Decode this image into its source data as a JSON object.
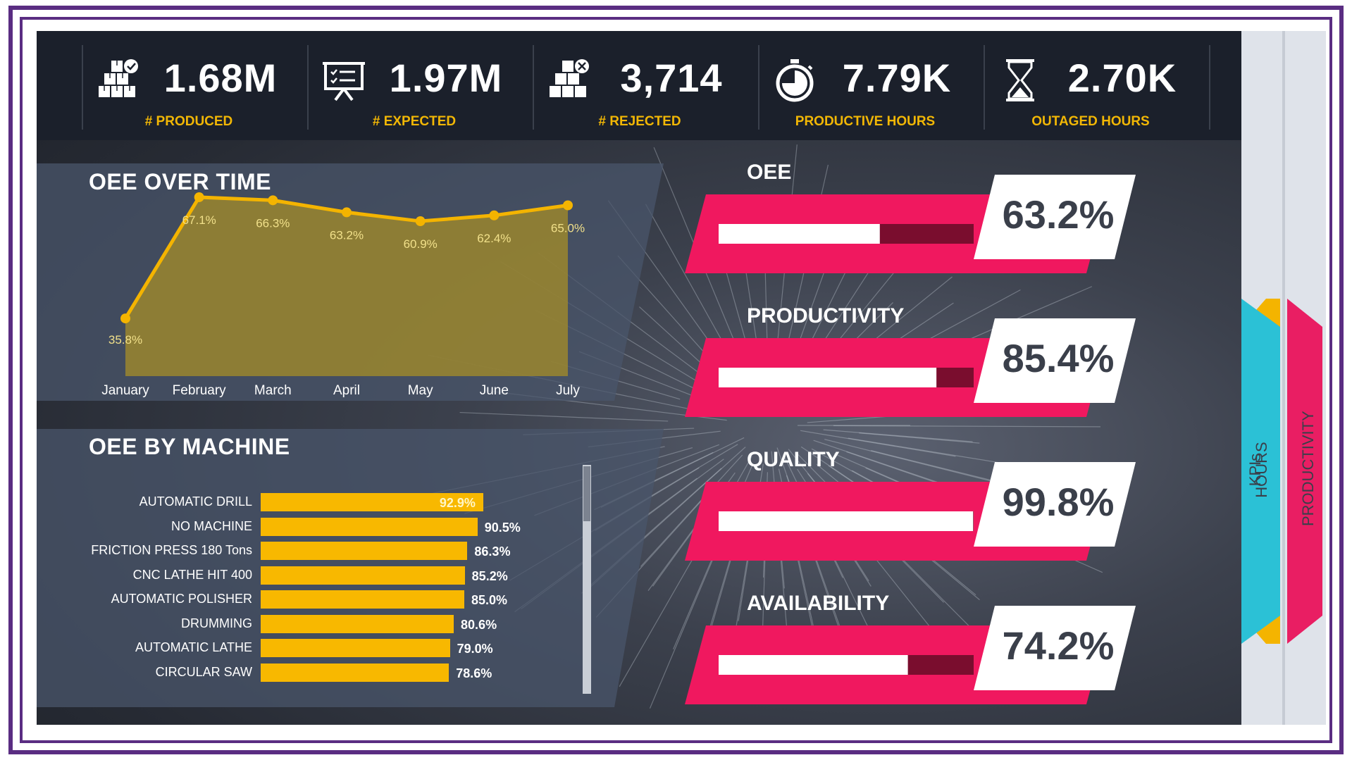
{
  "kpis": [
    {
      "value": "1.68M",
      "label": "# PRODUCED",
      "icon": "boxes-check-icon"
    },
    {
      "value": "1.97M",
      "label": "# EXPECTED",
      "icon": "presentation-board-icon"
    },
    {
      "value": "3,714",
      "label": "# REJECTED",
      "icon": "boxes-x-icon"
    },
    {
      "value": "7.79K",
      "label": "PRODUCTIVE HOURS",
      "icon": "stopwatch-icon"
    },
    {
      "value": "2.70K",
      "label": "OUTAGED HOURS",
      "icon": "hourglass-icon"
    }
  ],
  "oee_over_time": {
    "title": "OEE OVER TIME"
  },
  "oee_by_machine": {
    "title": "OEE BY MACHINE"
  },
  "gauges": [
    {
      "title": "OEE",
      "value": "63.2%",
      "fraction": 0.632
    },
    {
      "title": "PRODUCTIVITY",
      "value": "85.4%",
      "fraction": 0.854
    },
    {
      "title": "QUALITY",
      "value": "99.8%",
      "fraction": 0.998
    },
    {
      "title": "AVAILABILITY",
      "value": "74.2%",
      "fraction": 0.742
    }
  ],
  "tabs": [
    {
      "label": "KPIs",
      "color": "#f4b400"
    },
    {
      "label": "HOURS",
      "color": "#2bc1d6"
    },
    {
      "label": "PRODUCTIVITY",
      "color": "#e91e63"
    }
  ],
  "colors": {
    "accent_yellow": "#f4b400",
    "gauge_pink": "#f0185f",
    "gauge_dark": "#7a0d2e",
    "bar_yellow": "#f8b800"
  },
  "chart_data": [
    {
      "type": "area",
      "title": "OEE OVER TIME",
      "categories": [
        "January",
        "February",
        "March",
        "April",
        "May",
        "June",
        "July"
      ],
      "values": [
        35.8,
        67.1,
        66.3,
        63.2,
        60.9,
        62.4,
        65.0
      ],
      "data_labels": [
        "35.8%",
        "67.1%",
        "66.3%",
        "63.2%",
        "60.9%",
        "62.4%",
        "65.0%"
      ],
      "ylim": [
        20,
        80
      ],
      "grid": false
    },
    {
      "type": "bar",
      "title": "OEE BY MACHINE",
      "categories": [
        "AUTOMATIC DRILL",
        "NO MACHINE",
        "FRICTION PRESS 180 Tons",
        "CNC LATHE HIT 400",
        "AUTOMATIC POLISHER",
        "DRUMMING",
        "AUTOMATIC LATHE",
        "CIRCULAR SAW"
      ],
      "values": [
        92.9,
        90.5,
        86.3,
        85.2,
        85.0,
        80.6,
        79.0,
        78.6
      ],
      "data_labels": [
        "92.9%",
        "90.5%",
        "86.3%",
        "85.2%",
        "85.0%",
        "80.6%",
        "79.0%",
        "78.6%"
      ],
      "xlim": [
        0,
        100
      ],
      "orientation": "horizontal"
    }
  ]
}
